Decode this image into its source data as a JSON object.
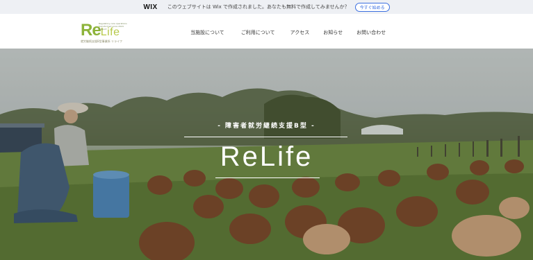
{
  "wix_banner": {
    "logo": "WIX",
    "message": "このウェブサイトは Wix で作成されました。あなたも無料で作成してみませんか？",
    "cta": "今すぐ始める"
  },
  "header": {
    "logo": {
      "main_re": "Re",
      "main_life": "Life",
      "tagline": "Regulatory-care operations transformed since 2024 support",
      "sub": "就労継続支援B型事業所 リライフ"
    },
    "nav": [
      {
        "label": "当施設について"
      },
      {
        "label": "ご利用について"
      },
      {
        "label": "アクセス"
      },
      {
        "label": "お知らせ"
      },
      {
        "label": "お問い合わせ"
      }
    ]
  },
  "hero": {
    "subtitle": "- 障害者就労継続支援B型 -",
    "title": "ReLife"
  },
  "colors": {
    "logo_green": "#8db33a",
    "wix_blue": "#3b6fe0",
    "banner_bg": "#eef0f4"
  }
}
